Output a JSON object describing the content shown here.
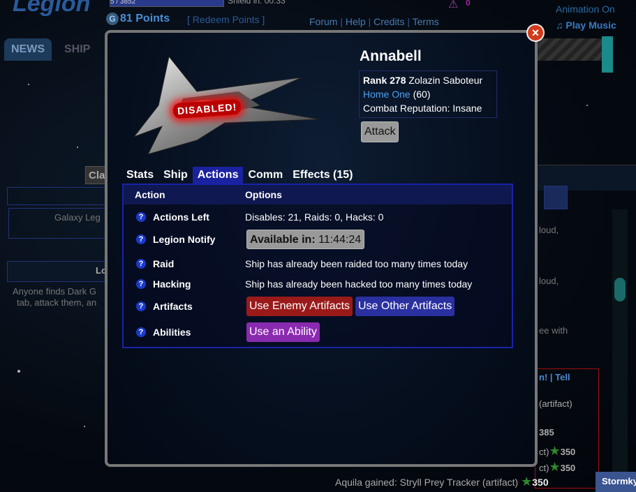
{
  "background": {
    "logo": "Legion",
    "xp_bar_text": "5 / 3852",
    "shield_label": "Shield in: 00:33",
    "points": "81 Points",
    "redeem": "[ Redeem Points ]",
    "links": [
      "Forum",
      "Help",
      "Credits",
      "Terms"
    ],
    "alert_count": "0",
    "animation_toggle": "Animation On",
    "play_music": "Play Music",
    "tabs": [
      "NEWS",
      "SHIP"
    ],
    "cla_fragment": "Cla",
    "galaxy_fragment": "Galaxy Leg",
    "lo_fragment": "Lo",
    "anyone_line1": "Anyone finds Dark G",
    "anyone_line2": "tab, attack them, an",
    "right_frag1": "loud,",
    "right_frag2": "loud,",
    "right_frag3": "ee with",
    "tell_frag": "n! | Tell",
    "artifact_frag": "(artifact)",
    "score_385": "385",
    "score_350a": "ct)",
    "val_350a": "350",
    "score_350b": "ct)",
    "val_350b": "350",
    "feed_line": "Aquila gained: Stryll Prey Tracker (artifact)",
    "feed_points": "350",
    "stormky": "Stormky"
  },
  "modal": {
    "status_badge": "DISABLED!",
    "player_name": "Annabell",
    "rank_label": "Rank",
    "rank_value": "278",
    "rank_title": "Zolazin Saboteur",
    "home_link": "Home One",
    "home_level": "(60)",
    "combat_reputation": "Combat Reputation: Insane",
    "attack_button": "Attack",
    "tabs": [
      {
        "label": "Stats"
      },
      {
        "label": "Ship"
      },
      {
        "label": "Actions"
      },
      {
        "label": "Comm"
      },
      {
        "label": "Effects (15)"
      }
    ],
    "active_tab": "Actions",
    "table": {
      "col_action": "Action",
      "col_options": "Options",
      "rows": {
        "actions_left": {
          "label": "Actions Left",
          "value": "Disables: 21, Raids: 0, Hacks: 0"
        },
        "legion_notify": {
          "label": "Legion Notify",
          "button_bold": "Available in:",
          "button_time": "11:44:24"
        },
        "raid": {
          "label": "Raid",
          "value": "Ship has already been raided too many times today"
        },
        "hacking": {
          "label": "Hacking",
          "value": "Ship has already been hacked too many times today"
        },
        "artifacts": {
          "label": "Artifacts",
          "enemy_button": "Use Enemy Artifacts",
          "other_button": "Use Other Artifacts"
        },
        "abilities": {
          "label": "Abilities",
          "ability_button": "Use an Ability"
        }
      }
    },
    "help_glyph": "?",
    "close_glyph": "×"
  },
  "colors": {
    "tab_active": "#1a22a0",
    "panel_border": "#1a22a8",
    "btn_red": "#9a1a1a",
    "btn_blue": "#2a30a0",
    "btn_purple": "#8a2ab0",
    "link_blue": "#4aa0f0",
    "close_red": "#d23a1a"
  }
}
